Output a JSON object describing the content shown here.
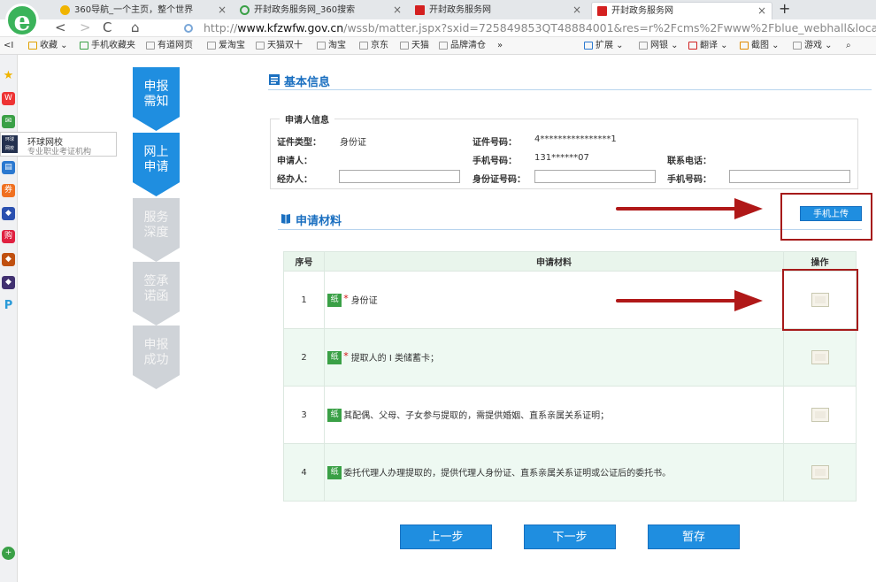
{
  "browser": {
    "tabs": [
      {
        "label": "360导航_一个主页，整个世界",
        "active": false,
        "color": "#f0b400"
      },
      {
        "label": "开封政务服务网_360搜索",
        "active": false,
        "color": "#3aa046"
      },
      {
        "label": "开封政务服务网",
        "active": false,
        "color": "#d42020"
      },
      {
        "label": "开封政务服务网",
        "active": true,
        "color": "#d42020"
      }
    ],
    "new_tab": "+",
    "back": "<",
    "forward": ">",
    "refresh": "C",
    "home": "⌂",
    "url_scheme": "http://",
    "url_host": "www.kfzwfw.gov.cn",
    "url_rest": "/wssb/matter.jspx?sxid=725849853QT48884001&res=r%2Fcms%2Fwww%2Fblue_webhall&location=",
    "bookmarks_left": [
      "收藏",
      "手机收藏夹",
      "有道网页",
      "爱淘宝",
      "天猫双十",
      "淘宝",
      "京东",
      "天猫",
      "品牌清仓",
      "»"
    ],
    "bookmarks_right": [
      "扩展",
      "网银",
      "翻译",
      "截图",
      "游戏"
    ],
    "side_popup": {
      "title": "环球网校",
      "subtitle": "专业职业考证机构"
    }
  },
  "steps": [
    {
      "label": "申报需知",
      "l1": "申报",
      "l2": "需知",
      "active": true
    },
    {
      "label": "网上申请",
      "l1": "网上",
      "l2": "申请",
      "active": true
    },
    {
      "label": "服务深度",
      "l1": "服务",
      "l2": "深度",
      "active": false
    },
    {
      "label": "签承诺函",
      "l1": "签承",
      "l2": "诺函",
      "active": false
    },
    {
      "label": "申报成功",
      "l1": "申报",
      "l2": "成功",
      "active": false
    }
  ],
  "basic": {
    "title": "基本信息",
    "legend": "申请人信息",
    "id_type_label": "证件类型：",
    "id_type_value": "身份证",
    "id_no_label": "证件号码：",
    "id_no_value": "4****************1",
    "applicant_label": "申请人：",
    "mobile_label": "手机号码：",
    "mobile_value": "131******07",
    "phone_label": "联系电话：",
    "agent_label": "经办人：",
    "agent_id_label": "身份证号码：",
    "agent_mobile_label": "手机号码："
  },
  "materials": {
    "title": "申请材料",
    "upload_button": "手机上传",
    "headers": {
      "no": "序号",
      "name": "申请材料",
      "op": "操作"
    },
    "tag": "纸",
    "rows": [
      {
        "no": "1",
        "required": true,
        "name": "身份证"
      },
      {
        "no": "2",
        "required": true,
        "name": "提取人的 I 类储蓄卡；"
      },
      {
        "no": "3",
        "required": false,
        "name": "其配偶、父母、子女参与提取的，需提供婚姻、直系亲属关系证明；"
      },
      {
        "no": "4",
        "required": false,
        "name": "委托代理人办理提取的，提供代理人身份证、直系亲属关系证明或公证后的委托书。"
      }
    ]
  },
  "footer": {
    "prev": "上一步",
    "next": "下一步",
    "save": "暂存"
  },
  "colors": {
    "accent": "#1f8ee0",
    "annotation": "#b01818",
    "tag": "#3aa046"
  }
}
